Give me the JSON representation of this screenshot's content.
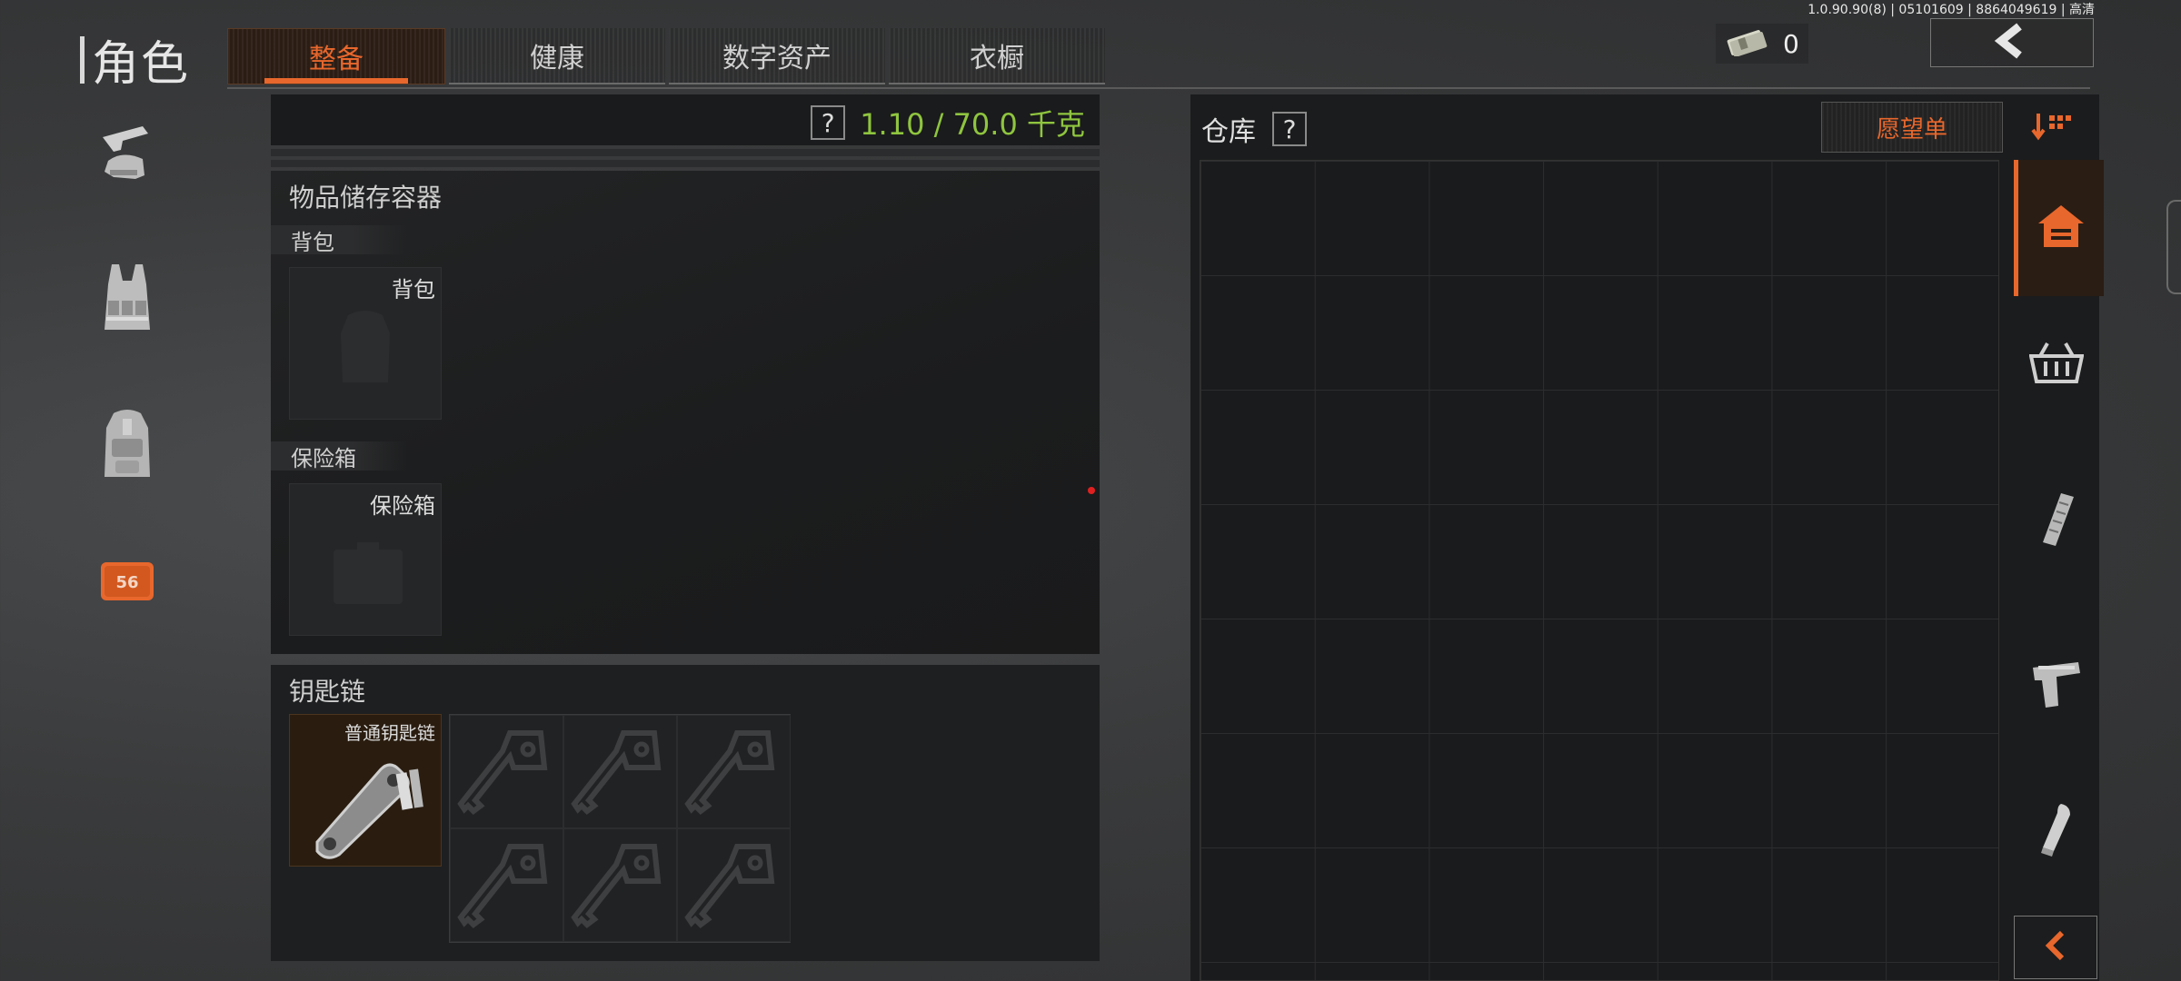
{
  "build_info": "1.0.90.90(8) | 05101609 | 8864049619 | 高清",
  "page_title": "角色",
  "tabs": [
    {
      "label": "整备",
      "active": true
    },
    {
      "label": "健康",
      "active": false
    },
    {
      "label": "数字资产",
      "active": false
    },
    {
      "label": "衣橱",
      "active": false
    }
  ],
  "currency": {
    "amount": "0",
    "icon": "cash-stack-icon"
  },
  "side_nav": [
    {
      "icon": "gun-helmet-icon"
    },
    {
      "icon": "vest-icon"
    },
    {
      "icon": "backpack-icon"
    },
    {
      "icon": "safe-case-icon",
      "badge": "56"
    }
  ],
  "weight": {
    "help": "?",
    "text": "1.10 / 70.0 千克",
    "color": "#8fc53f"
  },
  "storage": {
    "title": "物品储存容器",
    "backpack": {
      "header": "背包",
      "slot_label": "背包"
    },
    "safe": {
      "header": "保险箱",
      "slot_label": "保险箱"
    }
  },
  "keychain": {
    "title": "钥匙链",
    "item_label": "普通钥匙链",
    "key_slots": 6
  },
  "warehouse": {
    "title": "仓库",
    "help": "?",
    "wishlist_label": "愿望单",
    "rail": [
      {
        "icon": "home-icon",
        "active": true
      },
      {
        "icon": "basket-icon",
        "active": false
      },
      {
        "icon": "magazine-icon",
        "active": false
      },
      {
        "icon": "pistol-icon",
        "active": false
      },
      {
        "icon": "bullet-icon",
        "active": false
      }
    ]
  },
  "colors": {
    "accent": "#e8672c",
    "weight_green": "#8fc53f"
  }
}
